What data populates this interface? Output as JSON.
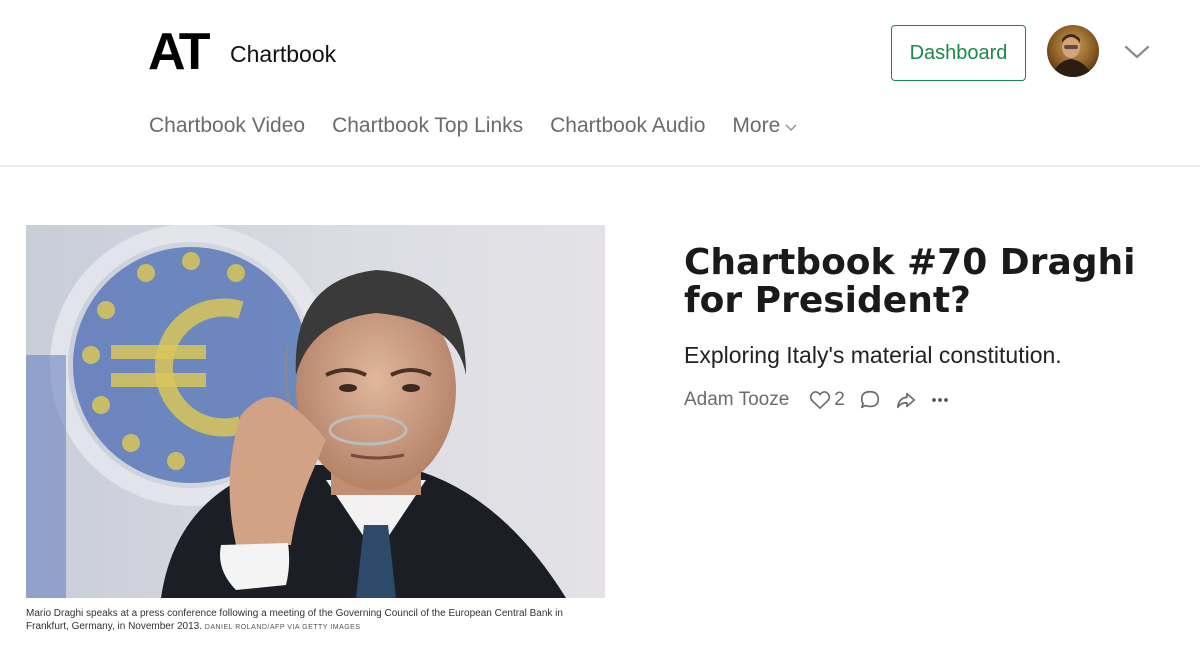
{
  "header": {
    "logo_text": "AT",
    "publication_name": "Chartbook",
    "dashboard_label": "Dashboard",
    "accent_color": "#1a8a4a"
  },
  "nav": {
    "items": [
      "Chartbook Video",
      "Chartbook Top Links",
      "Chartbook Audio"
    ],
    "more_label": "More"
  },
  "post": {
    "title": "Chartbook #70 Draghi for President?",
    "subtitle": "Exploring Italy's material constitution.",
    "author": "Adam Tooze",
    "like_count": "2",
    "image_caption": "Mario Draghi speaks at a press conference following a meeting of the Governing Council of the European Central Bank in Frankfurt, Germany, in November 2013.",
    "image_credit": "DANIEL ROLAND/AFP VIA GETTY IMAGES"
  },
  "icons": {
    "like": "heart-icon",
    "comment": "comment-icon",
    "share": "share-icon",
    "more": "ellipsis-icon",
    "account_menu": "chevron-down-icon"
  }
}
